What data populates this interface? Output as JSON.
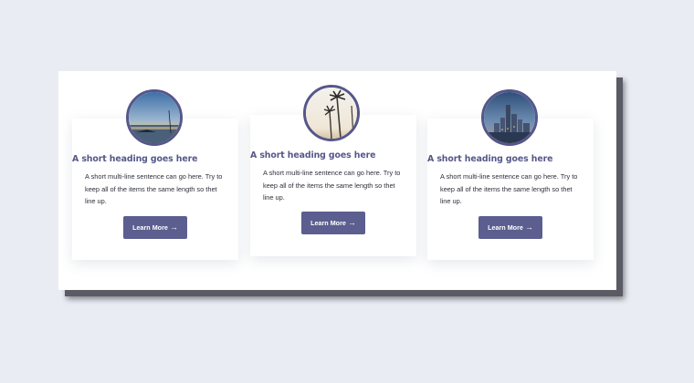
{
  "cards": [
    {
      "image": "lake-sunrise-photo",
      "heading": "A short heading goes here",
      "text": "A short multi-line sentence can go here. Try to keep all of the items the same length so thet line up.",
      "button_label": "Learn More",
      "button_icon": "arrow-right-icon"
    },
    {
      "image": "palm-trees-photo",
      "heading": "A short heading goes here",
      "text": "A short multi-line sentence can go here. Try to keep all of the items the same length so thet line up.",
      "button_label": "Learn More",
      "button_icon": "arrow-right-icon"
    },
    {
      "image": "city-skyline-photo",
      "heading": "A short heading goes here",
      "text": "A short multi-line sentence can go here. Try to keep all of the items the same length so thet line up.",
      "button_label": "Learn More",
      "button_icon": "arrow-right-icon"
    }
  ],
  "colors": {
    "page_background": "#e9edf3",
    "accent": "#55578a",
    "button": "#5b5e8f",
    "card": "#ffffff"
  }
}
